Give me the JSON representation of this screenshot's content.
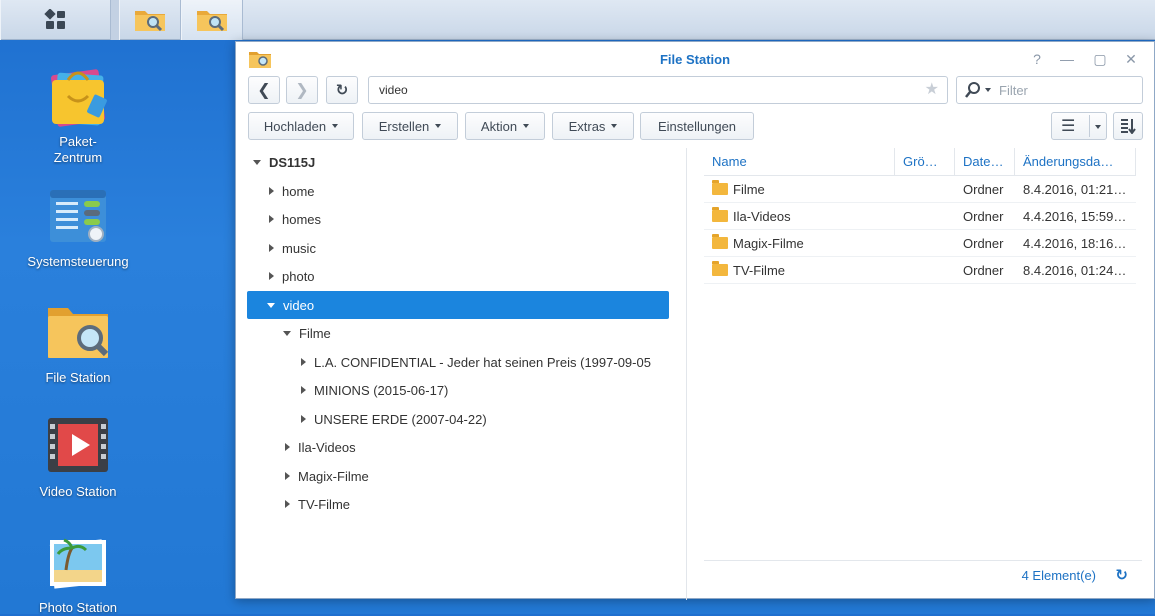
{
  "desktop": {
    "icons": [
      {
        "label": "Paket-\nZentrum",
        "icon": "package-center-icon"
      },
      {
        "label": "Systemsteuerung",
        "icon": "control-panel-icon"
      },
      {
        "label": "File Station",
        "icon": "file-station-icon"
      },
      {
        "label": "Video Station",
        "icon": "video-station-icon"
      },
      {
        "label": "Photo Station",
        "icon": "photo-station-icon"
      }
    ]
  },
  "window": {
    "title": "File Station",
    "path": "video",
    "filter_placeholder": "Filter",
    "toolbar": {
      "upload": "Hochladen",
      "create": "Erstellen",
      "action": "Aktion",
      "extras": "Extras",
      "settings": "Einstellungen"
    }
  },
  "tree": {
    "root": "DS115J",
    "items": [
      {
        "label": "home",
        "level": 1,
        "expanded": false
      },
      {
        "label": "homes",
        "level": 1,
        "expanded": false
      },
      {
        "label": "music",
        "level": 1,
        "expanded": false
      },
      {
        "label": "photo",
        "level": 1,
        "expanded": false
      },
      {
        "label": "video",
        "level": 1,
        "expanded": true,
        "selected": true
      },
      {
        "label": "Filme",
        "level": 2,
        "expanded": true
      },
      {
        "label": "L.A. CONFIDENTIAL - Jeder hat seinen Preis (1997-09-05",
        "level": 3,
        "expanded": false
      },
      {
        "label": "MINIONS (2015-06-17)",
        "level": 3,
        "expanded": false
      },
      {
        "label": "UNSERE ERDE (2007-04-22)",
        "level": 3,
        "expanded": false
      },
      {
        "label": "Ila-Videos",
        "level": 2,
        "expanded": false
      },
      {
        "label": "Magix-Filme",
        "level": 2,
        "expanded": false
      },
      {
        "label": "TV-Filme",
        "level": 2,
        "expanded": false
      }
    ]
  },
  "list": {
    "columns": [
      "Name",
      "Grö…",
      "Date…",
      "Änderungsda…"
    ],
    "rows": [
      {
        "name": "Filme",
        "size": "",
        "type": "Ordner",
        "modified": "8.4.2016, 01:21…"
      },
      {
        "name": "Ila-Videos",
        "size": "",
        "type": "Ordner",
        "modified": "4.4.2016, 15:59…"
      },
      {
        "name": "Magix-Filme",
        "size": "",
        "type": "Ordner",
        "modified": "4.4.2016, 18:16…"
      },
      {
        "name": "TV-Filme",
        "size": "",
        "type": "Ordner",
        "modified": "8.4.2016, 01:24…"
      }
    ],
    "status": "4 Element(e)"
  },
  "colors": {
    "accent": "#1d72c4",
    "selected": "#1b85de",
    "desktop": "#2278d4"
  }
}
